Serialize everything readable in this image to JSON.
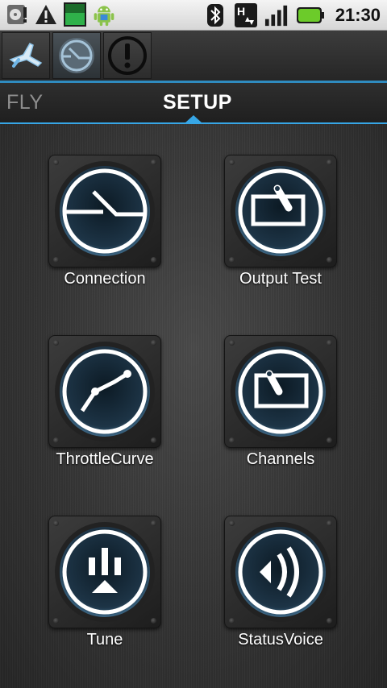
{
  "status_bar": {
    "time": "21:30",
    "icons": [
      "storage-warning-icon",
      "alert-icon",
      "battery-level-icon",
      "android-icon",
      "bluetooth-icon",
      "hsdpa-icon",
      "signal-icon",
      "battery-icon"
    ]
  },
  "action_strip": {
    "buttons": [
      "airplane-icon",
      "gauge-icon",
      "exclamation-icon"
    ]
  },
  "tabs": [
    {
      "label": "FLY",
      "active": false
    },
    {
      "label": "SETUP",
      "active": true
    }
  ],
  "accent_color": "#37a6e6",
  "tiles": [
    {
      "label": "Connection",
      "icon": "connection-gauge-icon"
    },
    {
      "label": "Output Test",
      "icon": "output-test-icon"
    },
    {
      "label": "ThrottleCurve",
      "icon": "throttle-curve-icon"
    },
    {
      "label": "Channels",
      "icon": "channels-icon"
    },
    {
      "label": "Tune",
      "icon": "tune-icon"
    },
    {
      "label": "StatusVoice",
      "icon": "status-voice-icon"
    }
  ]
}
